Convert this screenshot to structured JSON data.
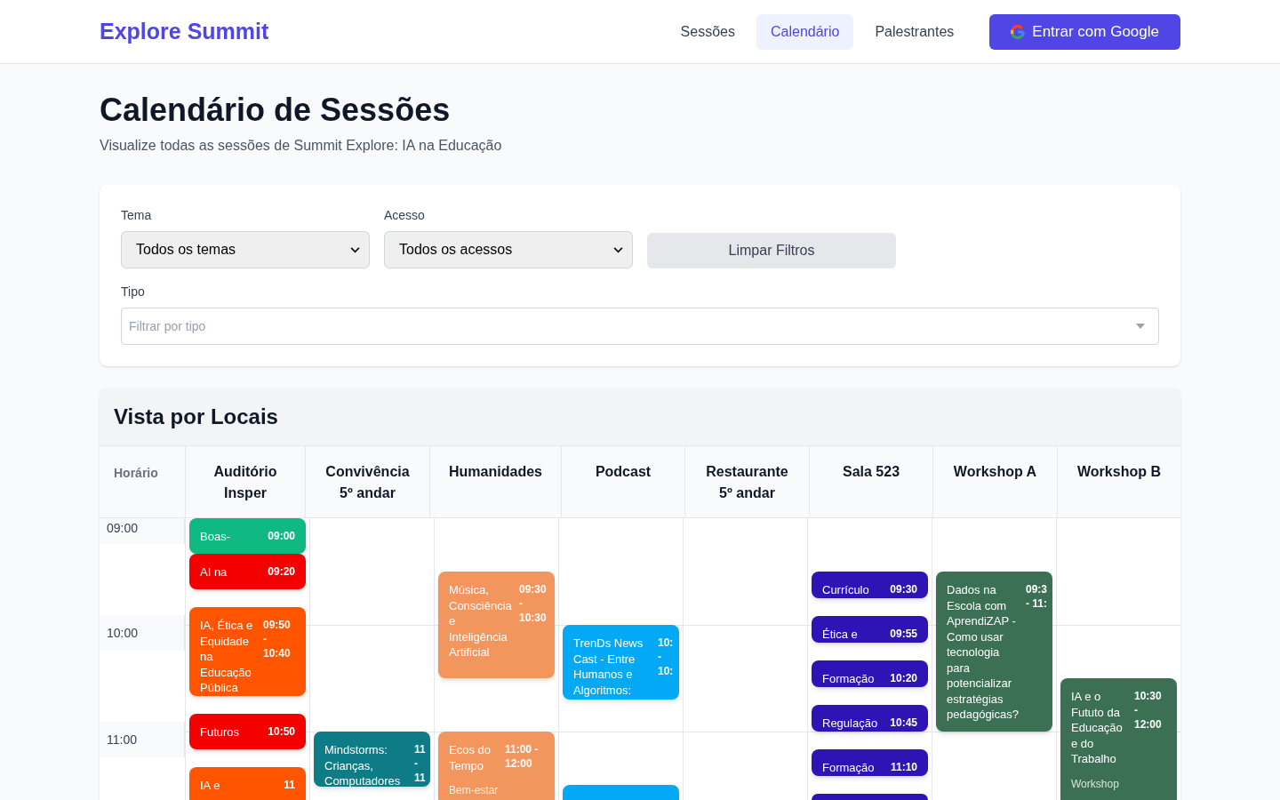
{
  "header": {
    "logo": "Explore Summit",
    "nav": [
      {
        "label": "Sessões",
        "selected": false
      },
      {
        "label": "Calendário",
        "selected": true
      },
      {
        "label": "Palestrantes",
        "selected": false
      }
    ],
    "login_button": "Entrar com Google"
  },
  "page": {
    "title": "Calendário de Sessões",
    "subtitle": "Visualize todas as sessões de Summit Explore: IA na Educação"
  },
  "filters": {
    "tema": {
      "label": "Tema",
      "value": "Todos os temas"
    },
    "acesso": {
      "label": "Acesso",
      "value": "Todos os acessos"
    },
    "clear_button": "Limpar Filtros",
    "tipo": {
      "label": "Tipo",
      "placeholder": "Filtrar por tipo"
    }
  },
  "calendar": {
    "title": "Vista por Locais",
    "time_header": "Horário",
    "hours": [
      "09:00",
      "10:00",
      "11:00"
    ],
    "columns": [
      {
        "name": "Auditório Insper",
        "events": [
          {
            "title": "Boas-",
            "time": "09:00",
            "color": "#10b981"
          },
          {
            "title": "AI na",
            "time": "09:20",
            "color": "#f50000"
          },
          {
            "title": "IA, Ética e Equidade na Educação Pública",
            "time": "09:50 - 10:40",
            "color": "#ff5500"
          },
          {
            "title": "Futuros",
            "time": "10:50",
            "color": "#f50000"
          },
          {
            "title": "IA e",
            "time": "11",
            "color": "#ff5500"
          }
        ]
      },
      {
        "name": "Convivência 5º andar",
        "events": [
          {
            "title": "Mindstorms: Crianças, Computadores",
            "time": "11 - 11",
            "color": "#0e7c86"
          }
        ]
      },
      {
        "name": "Humanidades",
        "events": [
          {
            "title": "Música, Consciência e Inteligência Artificial",
            "time": "09:30 - 10:30",
            "color": "#f2965e"
          },
          {
            "title": "Ecos do Tempo",
            "time": "11:00 - 12:00",
            "category": "Bem-estar",
            "color": "#f2965e"
          }
        ]
      },
      {
        "name": "Podcast",
        "events": [
          {
            "title": "TrenDs News Cast - Entre Humanos e Algoritmos:",
            "time": "10: - 10:",
            "color": "#03a9f4"
          },
          {
            "color": "#03a9f4"
          }
        ]
      },
      {
        "name": "Restaurante 5º andar"
      },
      {
        "name": "Sala 523",
        "events": [
          {
            "title": "Currículo",
            "time": "09:30",
            "color": "#2e13b5"
          },
          {
            "title": "Ética e",
            "time": "09:55",
            "color": "#2e13b5"
          },
          {
            "title": "Formação",
            "time": "10:20",
            "color": "#2e13b5"
          },
          {
            "title": "Regulação",
            "time": "10:45",
            "color": "#2e13b5"
          },
          {
            "title": "Formação",
            "time": "11:10",
            "color": "#2e13b5"
          },
          {
            "color": "#2e13b5"
          }
        ]
      },
      {
        "name": "Workshop A",
        "events": [
          {
            "title": "Dados na Escola com AprendiZAP - Como usar tecnologia para potencializar estratégias pedagógicas?",
            "time": "09:3 - 11:",
            "color": "#3b7055"
          }
        ]
      },
      {
        "name": "Workshop B",
        "events": [
          {
            "title": "IA e o Fututo da Educação e do Trabalho",
            "time": "10:30 - 12:00",
            "category": "Workshop",
            "color": "#3b7055"
          }
        ]
      }
    ]
  }
}
